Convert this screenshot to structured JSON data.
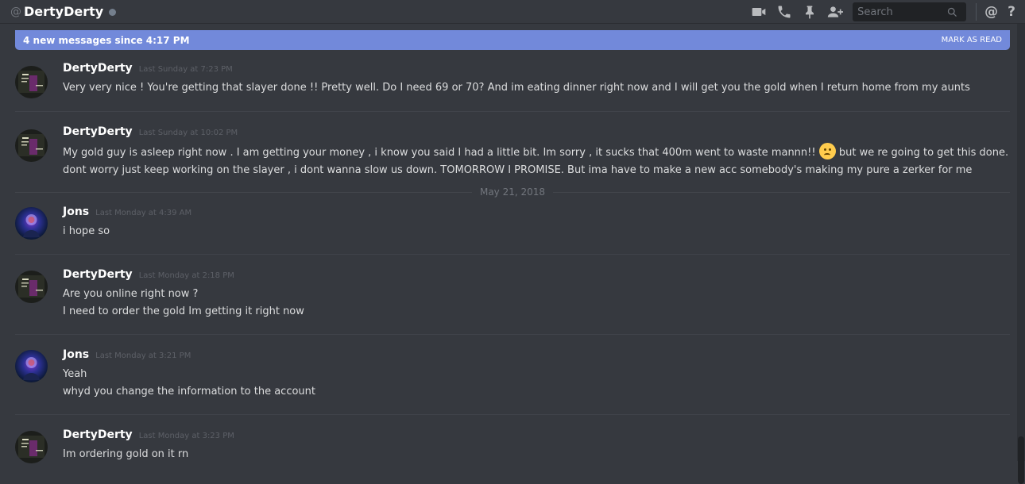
{
  "header": {
    "at_symbol": "@",
    "channel_name": "DertyDerty",
    "search_placeholder": "Search",
    "at_button": "@",
    "help_button": "?",
    "icons": [
      "video-call-icon",
      "voice-call-icon",
      "pin-icon",
      "add-friend-icon",
      "search-icon"
    ]
  },
  "banner": {
    "text": "4 new messages since 4:17 PM",
    "action": "MARK AS READ"
  },
  "date_divider": "May 21, 2018",
  "messages": [
    {
      "author": "DertyDerty",
      "time": "Last Sunday at 7:23 PM",
      "lines": [
        "Very very nice ! You're getting that slayer done !! Pretty well. Do I need 69 or 70? And im eating dinner right now and I will get you the gold when I return home from my aunts"
      ]
    },
    {
      "author": "DertyDerty",
      "time": "Last Sunday at 10:02 PM",
      "lines": [
        "My gold guy is asleep right now . I am getting your money , i know you said I had a little bit. Im sorry , it sucks that 400m went to waste mannn!!",
        "but we re going to get this done.",
        "dont worry just keep working on the slayer , i dont wanna slow us down. TOMORROW I PROMISE. But ima have to make a new acc somebody's making my pure a zerker for me"
      ]
    },
    {
      "author": "Jons",
      "time": "Last Monday at 4:39 AM",
      "lines": [
        "i hope so"
      ]
    },
    {
      "author": "DertyDerty",
      "time": "Last Monday at 2:18 PM",
      "lines": [
        "Are you online right now ?",
        "I need to order the gold Im getting it right now"
      ]
    },
    {
      "author": "Jons",
      "time": "Last Monday at 3:21 PM",
      "lines": [
        "Yeah",
        "whyd you change the information to the account"
      ]
    },
    {
      "author": "DertyDerty",
      "time": "Last Monday at 3:23 PM",
      "lines": [
        "Im ordering gold on it rn"
      ]
    }
  ],
  "colors": {
    "background": "#36393f",
    "banner": "#7289da",
    "search_bg": "#202225",
    "username": "#ffffff",
    "timestamp": "#5d6067"
  }
}
